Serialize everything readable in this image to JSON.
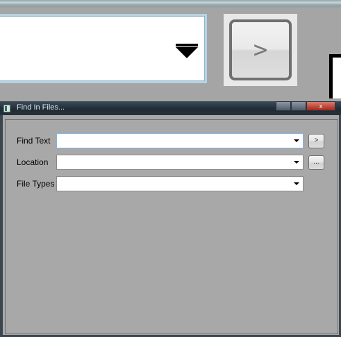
{
  "window": {
    "title": "Find In Files...",
    "controls": {
      "minimize": "",
      "maximize": "",
      "close": "x"
    }
  },
  "zoomed_fragment": {
    "button_glyph": ">"
  },
  "form": {
    "find_text": {
      "label": "Find Text",
      "value": "",
      "button": ">"
    },
    "location": {
      "label": "Location",
      "value": "",
      "button": "..."
    },
    "file_types": {
      "label": "File Types",
      "value": ""
    }
  },
  "colors": {
    "background": "#a8a8a8",
    "titlebar": "#1e2a34",
    "focus_border": "#7eb4ea"
  }
}
